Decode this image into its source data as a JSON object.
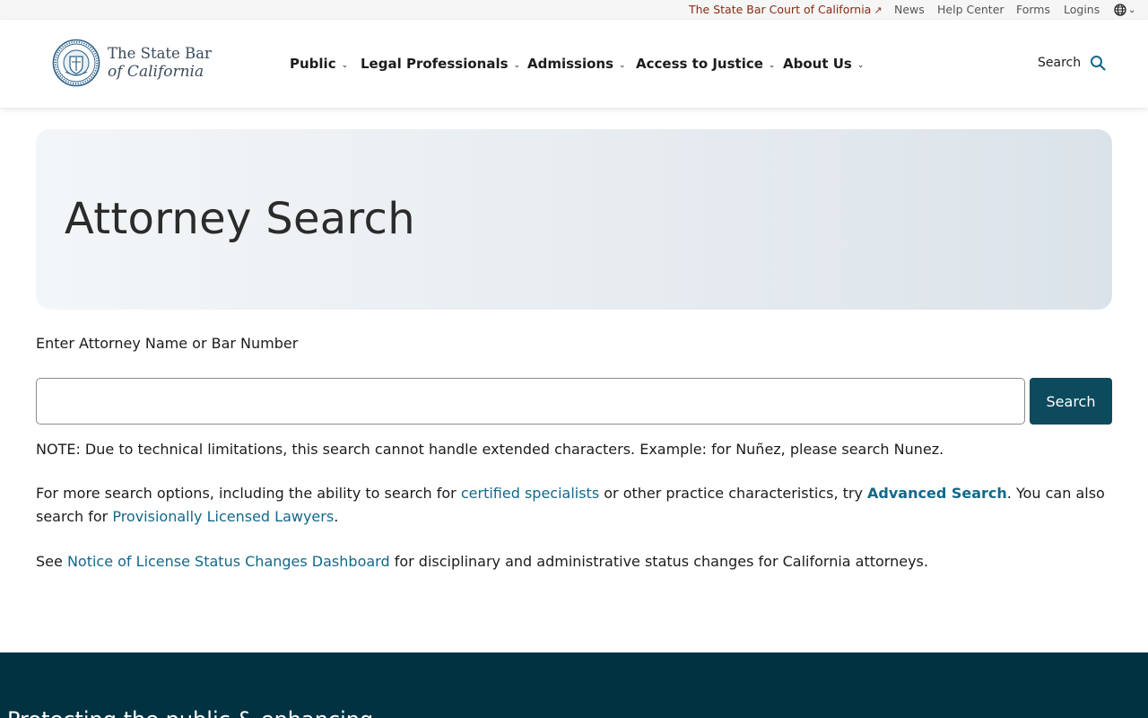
{
  "utility_nav": {
    "court_link": "The State Bar Court of California",
    "external_icon": "↗",
    "news": "News",
    "help_center": "Help Center",
    "forms": "Forms",
    "logins": "Logins",
    "language_icon": "globe-icon",
    "language_caret": "⌄"
  },
  "header": {
    "logo": {
      "line1": "The State Bar",
      "line2": "of California",
      "seal_color": "#2c5f86"
    },
    "nav": [
      {
        "label": "Public"
      },
      {
        "label": "Legal Professionals"
      },
      {
        "label": "Admissions"
      },
      {
        "label": "Access to Justice"
      },
      {
        "label": "About Us"
      }
    ],
    "nav_caret": "⌄",
    "search_label": "Search",
    "search_icon": "search-icon"
  },
  "hero": {
    "title": "Attorney Search"
  },
  "search_form": {
    "label": "Enter Attorney Name or Bar Number",
    "input_value": "",
    "input_placeholder": "",
    "button_label": "Search"
  },
  "content": {
    "note": "NOTE: Due to technical limitations, this search cannot handle extended characters. Example: for Nuñez, please search Nunez.",
    "more_part1": "For more search options, including the ability to search for ",
    "certified_specialists_link": "certified specialists",
    "more_part2": " or other practice characteristics, try ",
    "advanced_search_link": "Advanced Search",
    "more_part3": ". You can also search for ",
    "provisional_link": "Provisionally Licensed Lawyers",
    "more_part4": ".",
    "see_prefix": "See ",
    "dashboard_link": "Notice of License Status Changes Dashboard",
    "see_suffix": " for disciplinary and administrative status changes for California attorneys."
  },
  "footer": {
    "tagline": "Protecting the public & enhancing"
  },
  "colors": {
    "accent": "#0c4a5e",
    "link": "#13688a",
    "footer_bg": "#003242",
    "court_link": "#8a2a0f"
  }
}
